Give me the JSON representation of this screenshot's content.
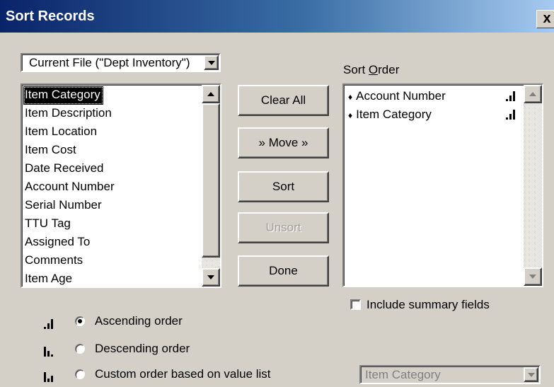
{
  "window": {
    "title": "Sort Records",
    "close_glyph": "x"
  },
  "source_combo": {
    "value": "Current File (\"Dept Inventory\")"
  },
  "field_list": {
    "items": [
      {
        "label": "Item Category",
        "selected": true
      },
      {
        "label": "Item Description"
      },
      {
        "label": "Item Location"
      },
      {
        "label": "Item Cost"
      },
      {
        "label": "Date Received"
      },
      {
        "label": "Account Number"
      },
      {
        "label": "Serial Number"
      },
      {
        "label": "TTU Tag"
      },
      {
        "label": "Assigned To"
      },
      {
        "label": "Comments"
      },
      {
        "label": "Item Age"
      }
    ]
  },
  "buttons": {
    "clear_all": "Clear All",
    "move": "» Move »",
    "sort": "Sort",
    "unsort": "Unsort",
    "done": "Done"
  },
  "sort_order": {
    "label_prefix": "Sort ",
    "label_underlined": "O",
    "label_suffix": "rder",
    "items": [
      {
        "label": "Account Number",
        "order": "ascending",
        "icon": "ascending-order-icon"
      },
      {
        "label": "Item Category",
        "order": "ascending",
        "icon": "ascending-order-icon"
      }
    ]
  },
  "include_summary": {
    "label": "Include summary fields",
    "checked": false
  },
  "order_options": [
    {
      "label": "Ascending order",
      "selected": true,
      "icon": "ascending-order-icon"
    },
    {
      "label": "Descending order",
      "selected": false,
      "icon": "descending-order-icon"
    },
    {
      "label": "Custom order based on value list",
      "selected": false,
      "icon": "custom-order-icon"
    }
  ],
  "value_list_combo": {
    "value": "Item Category",
    "enabled": false
  }
}
